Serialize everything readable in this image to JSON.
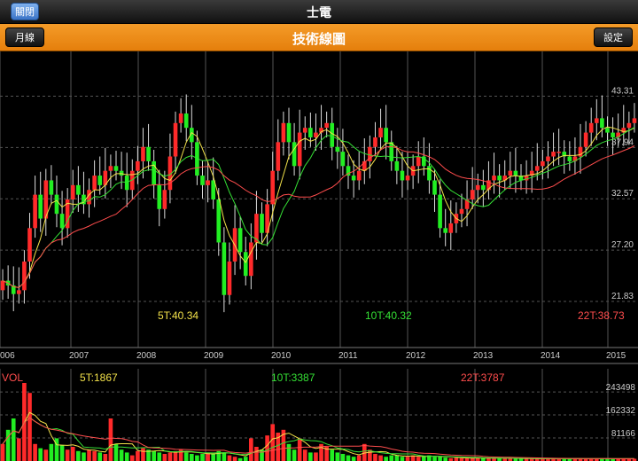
{
  "window": {
    "title": "士電",
    "close_label": "關閉"
  },
  "toolbar": {
    "title": "技術線圖",
    "period_label": "月線",
    "settings_label": "設定"
  },
  "colors": {
    "up": "#ff2a2a",
    "down": "#22ee22",
    "ma5": "#f2e14a",
    "ma10": "#35e035",
    "ma22": "#ff4d4d",
    "grid": "#555555"
  },
  "chart_data": [
    {
      "type": "candlestick",
      "x_ticks": [
        "006",
        "2007",
        "2008",
        "2009",
        "2010",
        "2011",
        "2012",
        "2013",
        "2014",
        "2015"
      ],
      "y_ticks": [
        "43.31",
        "37.94",
        "32.57",
        "27.20",
        "21.83"
      ],
      "ylim": [
        17,
        48
      ],
      "indicators": [
        "5T:40.34",
        "10T:40.32",
        "22T:38.73"
      ],
      "closes": [
        24.0,
        23.5,
        22.6,
        23.0,
        26.0,
        29.5,
        33.0,
        30.5,
        34.5,
        33.0,
        31.0,
        29.5,
        32.5,
        34.0,
        33.0,
        32.0,
        33.5,
        35.0,
        34.0,
        35.5,
        36.0,
        35.5,
        35.0,
        33.5,
        35.5,
        36.5,
        38.0,
        36.5,
        34.0,
        31.5,
        33.5,
        37.0,
        40.5,
        41.5,
        40.0,
        38.5,
        35.0,
        34.0,
        34.5,
        32.5,
        28.0,
        22.5,
        26.0,
        29.5,
        27.0,
        24.5,
        28.0,
        31.0,
        29.0,
        32.0,
        35.5,
        38.5,
        40.5,
        38.5,
        36.0,
        39.5,
        40.0,
        39.0,
        39.5,
        40.0,
        40.5,
        38.0,
        37.5,
        36.0,
        35.0,
        34.5,
        35.5,
        36.5,
        38.0,
        39.0,
        40.0,
        38.5,
        36.5,
        35.5,
        34.5,
        35.0,
        36.0,
        37.0,
        36.0,
        34.5,
        33.0,
        29.5,
        29.0,
        30.0,
        31.0,
        31.5,
        32.5,
        33.5,
        34.0,
        33.5,
        34.5,
        35.0,
        34.5,
        35.0,
        35.5,
        35.0,
        34.5,
        35.0,
        35.5,
        36.0,
        36.5,
        37.0,
        37.5,
        37.5,
        37.0,
        36.5,
        37.0,
        38.0,
        39.5,
        40.5,
        41.0,
        40.0,
        39.5,
        39.0,
        39.5,
        40.0,
        40.5,
        41.0
      ]
    },
    {
      "type": "bar",
      "label": "VOL",
      "y_ticks": [
        "243498",
        "162332",
        "81166"
      ],
      "ylim": [
        0,
        325000
      ],
      "indicators": [
        "5T:1867",
        "10T:3387",
        "22T:3787"
      ],
      "values": [
        60000,
        110000,
        150000,
        80000,
        275000,
        240000,
        60000,
        45000,
        40000,
        60000,
        80000,
        55000,
        40000,
        50000,
        35000,
        30000,
        40000,
        35000,
        30000,
        25000,
        150000,
        60000,
        40000,
        30000,
        20000,
        35000,
        45000,
        40000,
        35000,
        30000,
        25000,
        30000,
        35000,
        40000,
        30000,
        25000,
        20000,
        25000,
        30000,
        25000,
        35000,
        30000,
        20000,
        15000,
        10000,
        15000,
        80000,
        50000,
        40000,
        90000,
        130000,
        100000,
        110000,
        60000,
        40000,
        80000,
        40000,
        30000,
        30000,
        60000,
        50000,
        40000,
        30000,
        25000,
        20000,
        15000,
        20000,
        60000,
        40000,
        25000,
        20000,
        15000,
        20000,
        20000,
        15000,
        15000,
        20000,
        15000,
        15000,
        20000,
        15000,
        15000,
        12000,
        10000,
        12000,
        10000,
        10000,
        10000,
        12000,
        10000,
        10000,
        10000,
        10000,
        10000,
        10000,
        8000,
        8000,
        8000,
        8000,
        8000,
        8000,
        8000,
        8000,
        8000,
        8000,
        8000,
        8000,
        8000,
        8000,
        8000,
        8000,
        8000,
        8000,
        8000,
        8000,
        8000,
        8000,
        8000
      ]
    }
  ]
}
